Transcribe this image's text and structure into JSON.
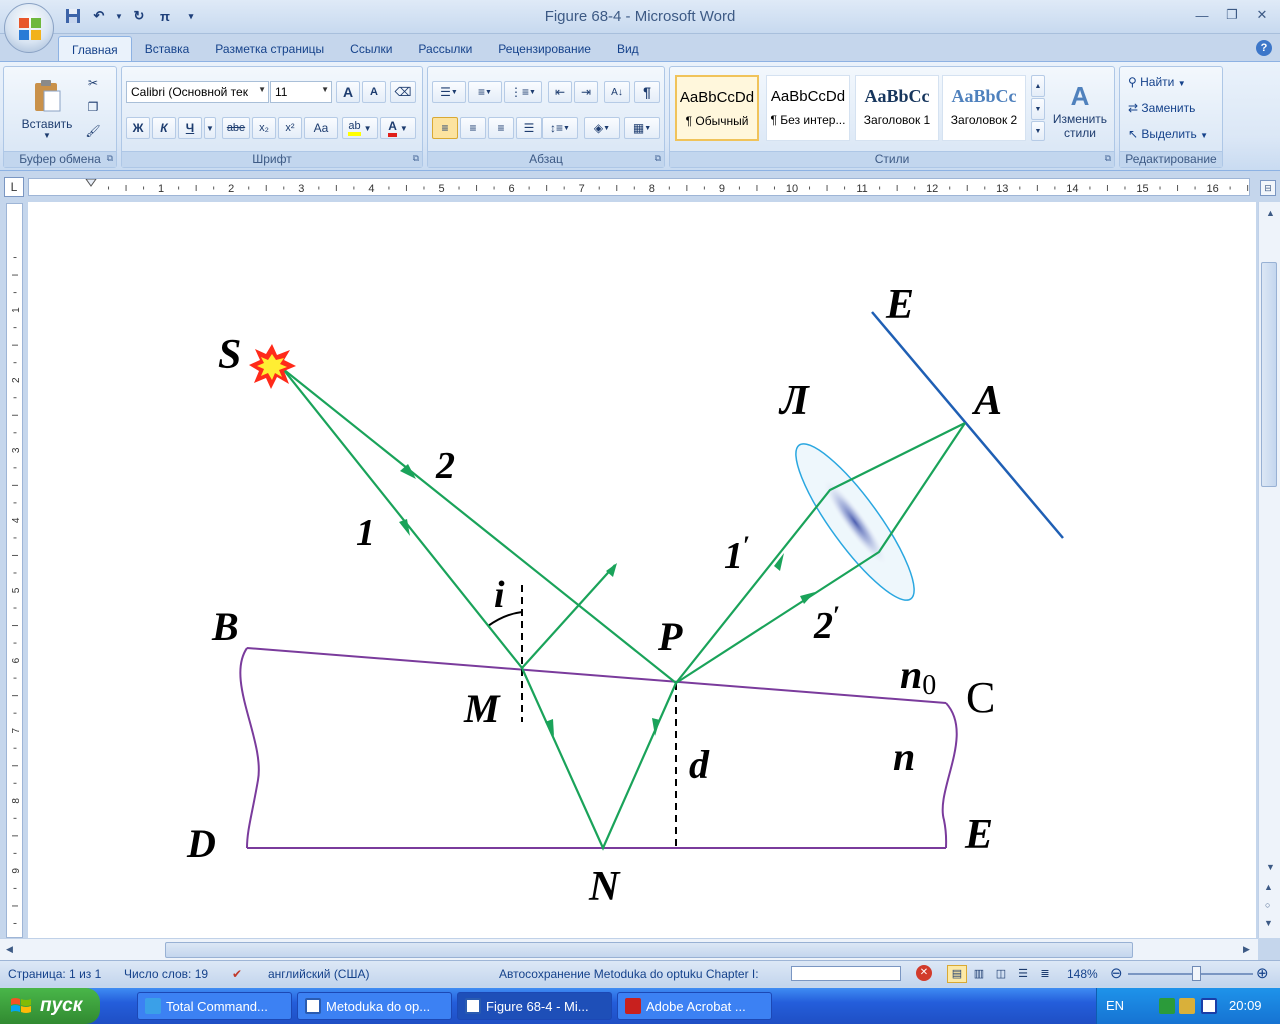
{
  "window": {
    "title": "Figure 68-4 - Microsoft Word"
  },
  "quick_access": {
    "pi_symbol": "π"
  },
  "tabs": [
    {
      "label": "Главная",
      "active": true
    },
    {
      "label": "Вставка"
    },
    {
      "label": "Разметка страницы"
    },
    {
      "label": "Ссылки"
    },
    {
      "label": "Рассылки"
    },
    {
      "label": "Рецензирование"
    },
    {
      "label": "Вид"
    }
  ],
  "ribbon": {
    "clipboard": {
      "label": "Буфер обмена",
      "paste": "Вставить"
    },
    "font": {
      "label": "Шрифт",
      "font_name": "Calibri (Основной тек",
      "font_size": "11",
      "bold": "Ж",
      "italic": "К",
      "underline": "Ч",
      "strike": "abe",
      "subscript": "x₂",
      "superscript": "x²",
      "case": "Aa",
      "grow": "A",
      "shrink": "A"
    },
    "paragraph": {
      "label": "Абзац",
      "pilcrow": "¶"
    },
    "styles": {
      "label": "Стили",
      "items": [
        {
          "sample": "AaBbCcDd",
          "name": "¶ Обычный",
          "active": true
        },
        {
          "sample": "AaBbCcDd",
          "name": "¶ Без интер..."
        },
        {
          "sample": "AaBbCc",
          "name": "Заголовок 1"
        },
        {
          "sample": "AaBbCc",
          "name": "Заголовок 2"
        }
      ],
      "change_styles": "Изменить стили"
    },
    "editing": {
      "label": "Редактирование",
      "find": "Найти",
      "replace": "Заменить",
      "select": "Выделить"
    }
  },
  "ruler": {
    "corner": "L",
    "h_numbers": [
      "1",
      "2",
      "3",
      "4",
      "5",
      "6",
      "7",
      "8",
      "9",
      "10",
      "11",
      "12",
      "13",
      "14",
      "15",
      "16"
    ],
    "v_numbers": [
      "1",
      "2",
      "3",
      "4",
      "5",
      "6",
      "7",
      "8",
      "9"
    ]
  },
  "figure": {
    "labels": {
      "S": "S",
      "ray1": "1",
      "ray2": "2",
      "i": "i",
      "B": "B",
      "M": "M",
      "P": "P",
      "n0": "n",
      "n0_sub": "0",
      "C": "C",
      "n": "n",
      "d": "d",
      "D": "D",
      "N": "N",
      "E_bottom": "E",
      "ray1p": "1",
      "ray2p": "2",
      "prime": "′",
      "lens": "Л",
      "A": "A",
      "E_top": "E"
    },
    "colors": {
      "rays": "#1aa35a",
      "prism": "#7a3b9c",
      "screen": "#1f5fb4",
      "lens_edge": "#2aa7e0",
      "source": "#ff2a1a"
    }
  },
  "status": {
    "page": "Страница: 1 из 1",
    "words": "Число слов: 19",
    "language": "английский (США)",
    "autosave": "Автосохранение Metoduka do optuku Chapter I:",
    "zoom": "148%"
  },
  "taskbar": {
    "start": "пуск",
    "tasks": [
      {
        "label": "Total Command...",
        "color": "#3aa0e8"
      },
      {
        "label": "Metoduka do op...",
        "color": "#2a5bb0"
      },
      {
        "label": "Figure 68-4 - Mi...",
        "color": "#2a5bb0",
        "active": true
      },
      {
        "label": "Adobe Acrobat ...",
        "color": "#c8201e"
      }
    ],
    "lang": "EN",
    "clock": "20:09"
  }
}
